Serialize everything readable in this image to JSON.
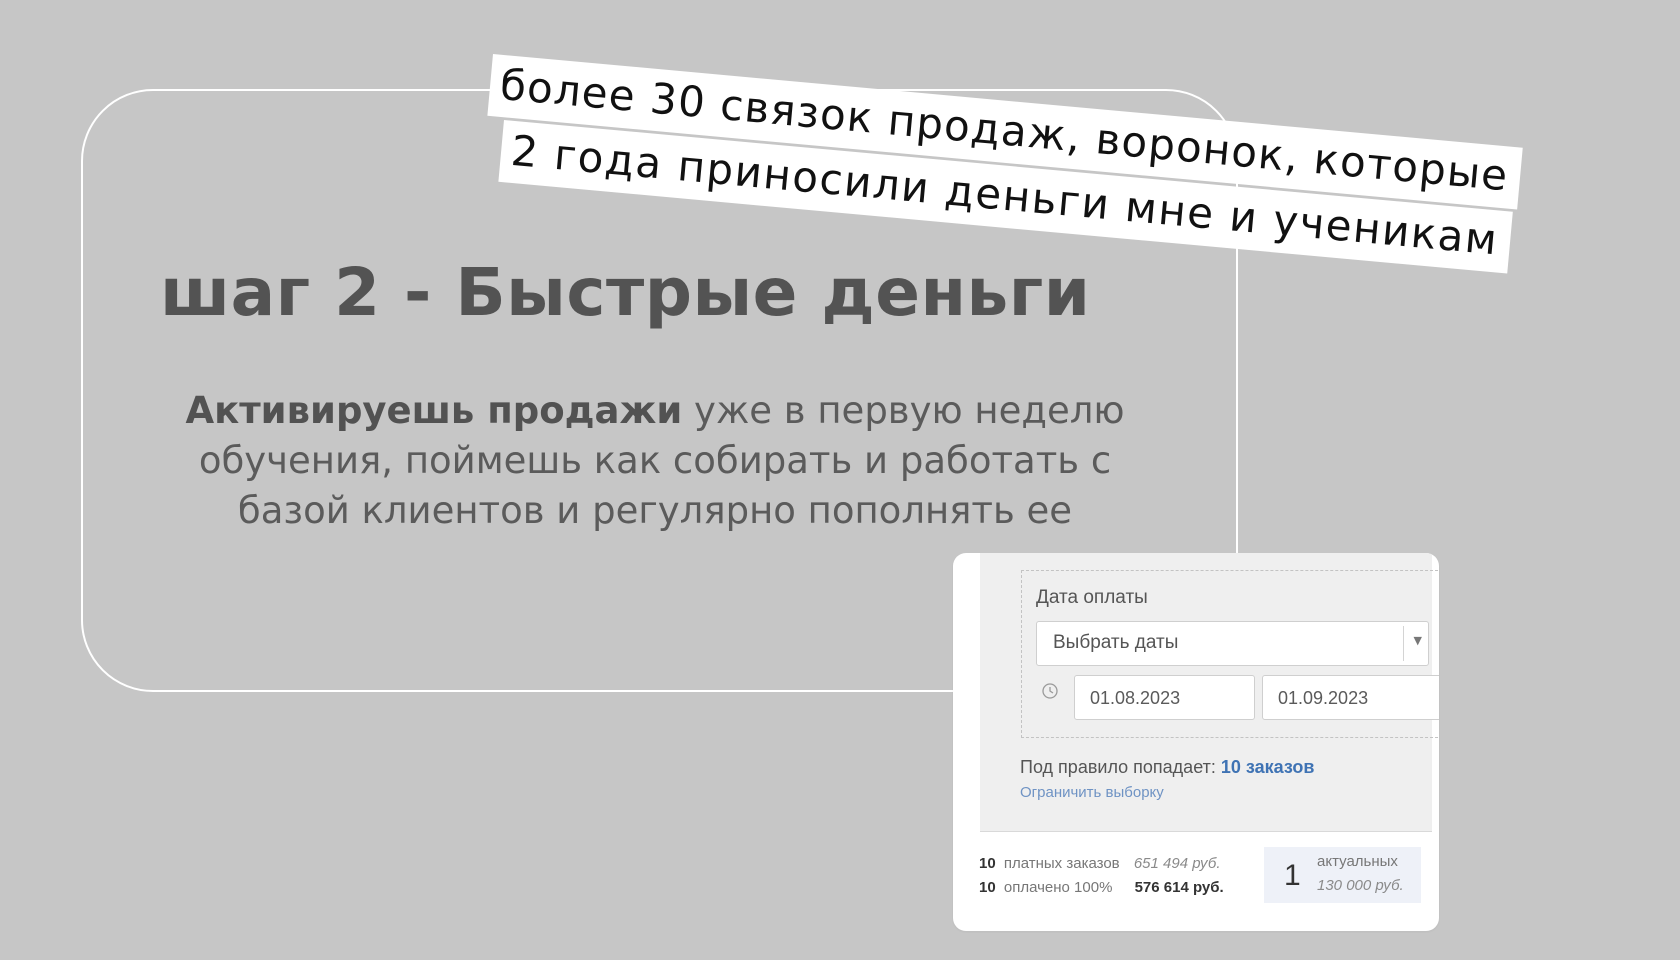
{
  "slide": {
    "headline": "шаг 2 - Быстрые деньги",
    "body_bold": "Активируешь продажи",
    "body_rest": " уже в первую неделю обучения, поймешь как собирать и работать с базой клиентов и регулярно пополнять ее",
    "sticker_line_1": "более 30 связок продаж, воронок, которые",
    "sticker_line_2": "2 года приносили деньги мне и ученикам"
  },
  "screenshot": {
    "payment_date_label": "Дата оплаты",
    "date_select_value": "Выбрать даты",
    "date_from": "01.08.2023",
    "date_to": "01.09.2023",
    "rule_text": "Под правило попадает: ",
    "rule_count": "10 заказов",
    "limit_link": "Ограничить выборку",
    "stats": [
      {
        "count": "10",
        "label": "платных заказов",
        "amount": "651 494 руб."
      },
      {
        "count": "10",
        "label": "оплачено 100%",
        "amount": "576 614 руб."
      }
    ],
    "actual": {
      "count": "1",
      "label": "актуальных",
      "amount": "130 000 руб."
    }
  },
  "icons": {
    "clock": "clock-icon",
    "dropdown": "chevron-down-icon"
  },
  "colors": {
    "background": "#c6c6c6",
    "headline": "#535353",
    "link_blue": "#3f73b4",
    "actual_box": "#eef1f8"
  }
}
